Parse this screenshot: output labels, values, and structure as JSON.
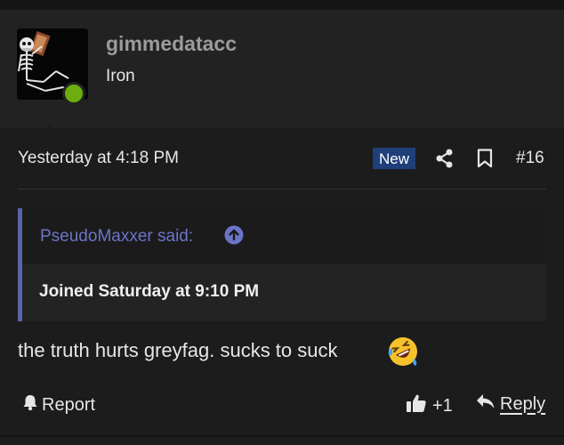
{
  "post": {
    "username": "gimmedatacc",
    "user_title": "Iron",
    "date": "Yesterday at 4:18 PM",
    "new_badge": "New",
    "post_number": "#16",
    "quote": {
      "author": "PseudoMaxxer said:",
      "text": "Joined Saturday at 9:10 PM"
    },
    "message": "the truth hurts greyfag. sucks to suck",
    "message_emoji": "rolling-on-floor-laughing-emoji",
    "actions": {
      "report": "Report",
      "like_count": "+1",
      "reply": "Reply"
    }
  },
  "colors": {
    "background": "#1c1c1c",
    "user_block": "#222222",
    "online_status": "#6cad10",
    "new_badge": "#1f3f7a",
    "quote_accent": "#5a64a8",
    "quote_author": "#6c74c8"
  },
  "icons": [
    "share-icon",
    "bookmark-icon",
    "quote-jump-icon",
    "bell-icon",
    "thumbs-up-icon",
    "reply-icon"
  ]
}
